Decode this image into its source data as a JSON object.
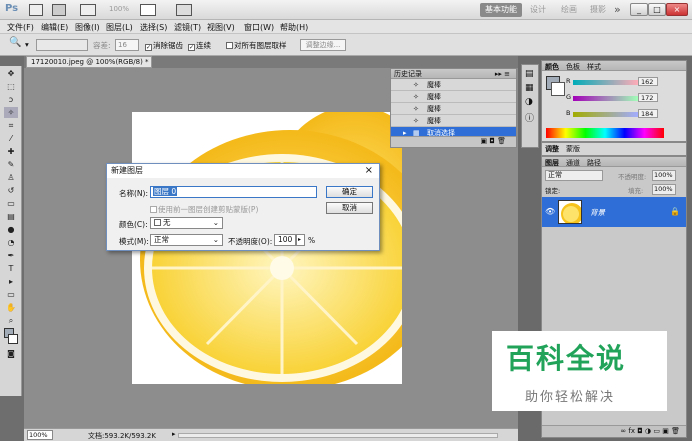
{
  "titlebar": {
    "logo": "Ps",
    "zoom": "100%",
    "workspaces": [
      "基本功能",
      "设计",
      "绘画",
      "摄影"
    ],
    "more": "»",
    "min": "_",
    "restore": "□",
    "close": "×"
  },
  "menu": [
    "文件(F)",
    "编辑(E)",
    "图像(I)",
    "图层(L)",
    "选择(S)",
    "滤镜(T)",
    "视图(V)",
    "窗口(W)",
    "帮助(H)"
  ],
  "options": {
    "tolerance_label": "容差:",
    "tolerance_value": "16",
    "antialias": "消除锯齿",
    "contiguous": "连续",
    "all_layers": "对所有图层取样",
    "refine": "调整边缘..."
  },
  "document": {
    "tab": "17120010.jpeg @ 100%(RGB/8) *",
    "tab_close": "×",
    "zoom": "100%",
    "docsize": "文档:593.2K/593.2K"
  },
  "history": {
    "title": "历史记录",
    "items": [
      "魔棒",
      "魔棒",
      "魔棒",
      "魔棒",
      "取消选择"
    ],
    "selected_index": 4
  },
  "color_panel": {
    "tabs": [
      "颜色",
      "色板",
      "样式"
    ],
    "channels": [
      {
        "name": "R",
        "value": "162"
      },
      {
        "name": "G",
        "value": "172"
      },
      {
        "name": "B",
        "value": "184"
      }
    ]
  },
  "adjust_panel": {
    "tabs": [
      "调整",
      "蒙版"
    ]
  },
  "layers_panel": {
    "tabs": [
      "图层",
      "通道",
      "路径"
    ],
    "blend_mode": "正常",
    "opacity_label": "不透明度:",
    "opacity_value": "100%",
    "lock_label": "锁定:",
    "fill_label": "填充:",
    "fill_value": "100%",
    "layer_name": "背景"
  },
  "dialog": {
    "title": "新建图层",
    "close": "×",
    "name_label": "名称(N):",
    "name_value": "图层 0",
    "clip_option": "使用前一图层创建剪贴蒙版(P)",
    "color_label": "颜色(C):",
    "color_value": "无",
    "mode_label": "模式(M):",
    "mode_value": "正常",
    "opacity_label": "不透明度(O):",
    "opacity_value": "100",
    "opacity_unit": "%",
    "ok": "确定",
    "cancel": "取消"
  },
  "watermark": {
    "line1": "百科全说",
    "line2": "助你轻松解决"
  },
  "colors": {
    "accent": "#2e6ed6",
    "watermark_green": "#21a35a",
    "lemon": "#f6c21c"
  }
}
